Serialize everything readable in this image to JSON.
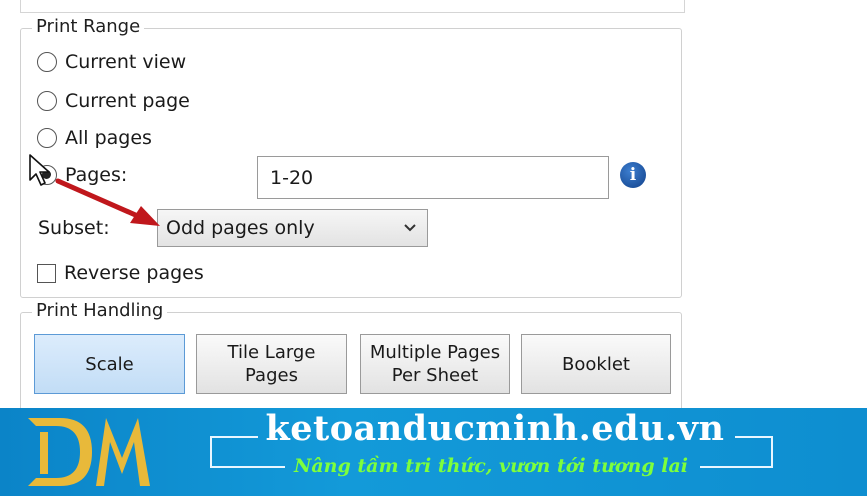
{
  "print_range": {
    "legend": "Print Range",
    "options": [
      {
        "label": "Current view",
        "checked": false
      },
      {
        "label": "Current page",
        "checked": false
      },
      {
        "label": "All pages",
        "checked": false
      },
      {
        "label": "Pages:",
        "checked": true
      }
    ],
    "pages_value": "1-20",
    "subset_label": "Subset:",
    "subset_value": "Odd pages only",
    "reverse_label": "Reverse pages",
    "reverse_checked": false
  },
  "print_handling": {
    "legend": "Print Handling",
    "buttons": [
      {
        "line1": "Scale",
        "line2": "",
        "selected": true
      },
      {
        "line1": "Tile Large",
        "line2": "Pages",
        "selected": false
      },
      {
        "line1": "Multiple Pages",
        "line2": "Per Sheet",
        "selected": false
      },
      {
        "line1": "Booklet",
        "line2": "",
        "selected": false
      }
    ]
  },
  "banner": {
    "site": "ketoanducminh.edu.vn",
    "tagline": "Nâng tầm tri thức, vươn tới tương lai",
    "logo_icon": "dm-logo-icon",
    "background_color": "#1296d6",
    "tagline_color": "#7dff3c"
  },
  "accent": {
    "selected_button": "#c2ddf6",
    "annotation_arrow": "#c0171c",
    "info_icon": "#1e5bb0"
  }
}
